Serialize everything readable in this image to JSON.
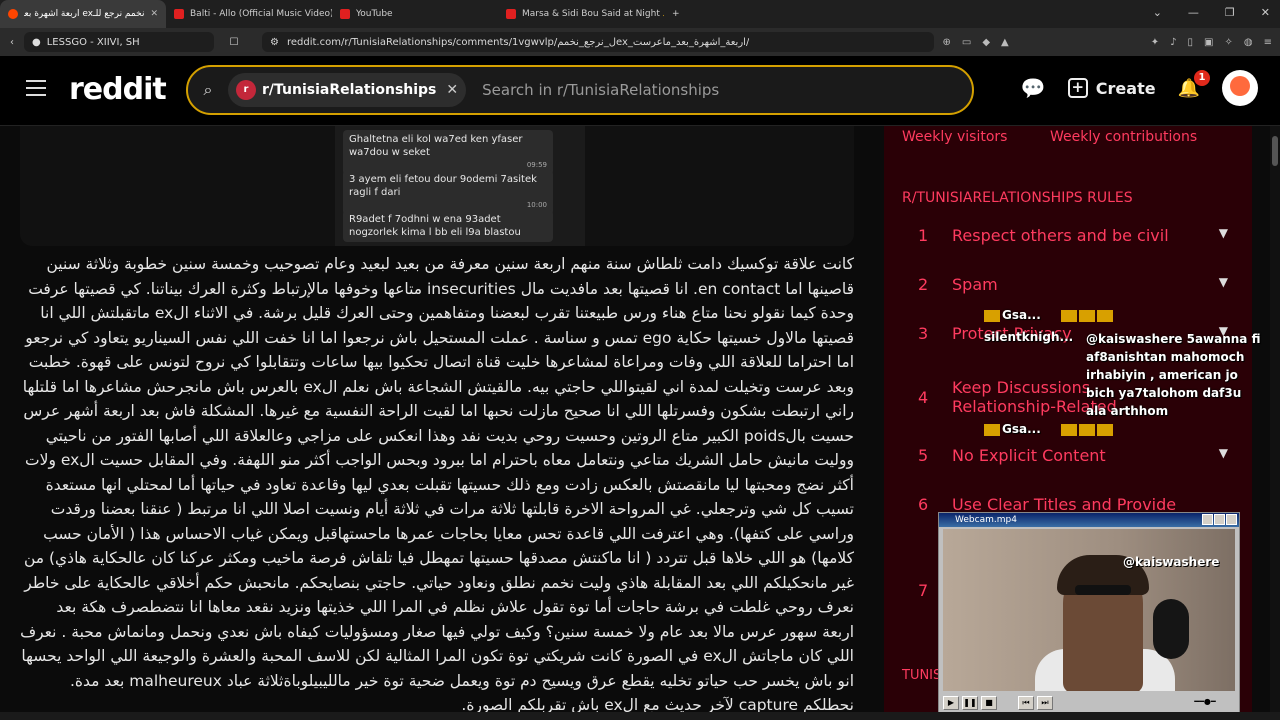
{
  "browser": {
    "tabs": [
      {
        "title": "نخمم نرجع للـex اربعة اشهرة بعد",
        "active": true
      },
      {
        "title": "Balti - Allo (Official Music Video) - Yo",
        "active": false
      },
      {
        "title": "YouTube",
        "active": false
      },
      {
        "title": "Marsa & Sidi Bou Said at Night 🌙 |",
        "active": false
      }
    ],
    "profile_label": "LESSGO - XIIVI, SH",
    "url": "reddit.com/r/TunisiaRelationships/comments/1vgwvlp/ل_نرجع_نخممex_اربعة_اشهرة_بعد_ماعرست/"
  },
  "header": {
    "logo": "reddit",
    "community_chip": "r/TunisiaRelationships",
    "search_placeholder": "Search in r/TunisiaRelationships",
    "create_label": "Create",
    "notification_count": "1"
  },
  "chat_image": {
    "messages": [
      {
        "text": "Ghaltetna eli kol wa7ed ken yfaser wa7dou w seket",
        "time": "09:59"
      },
      {
        "text": "3 ayem eli fetou dour 9odemi 7asitek ragli f dari",
        "time": "10:00"
      },
      {
        "text": "R9adet f 7odhni w ena 93adet nogzorlek kima l bb eli l9a blastou",
        "time": ""
      }
    ]
  },
  "post": {
    "paragraphs": [
      "كانت علاقة توكسيك دامت ثلطاش سنة منهم اربعة سنين معرفة من بعيد لبعيد وعام تصوحيب وخمسة سنين خطوبة وثلاثة سنين قاصينها اما en contact. انا قصيتها بعد مافديت مال insecurities متاعها وخوفها مالإرتباط وكثرة العرك بيناتنا. كي قصيتها عرفت وحدة كيما نقولو نحنا متاع هناء ورس طبيعتنا تقرب لبعضنا ومتفاهمين وحتى العرك قليل برشة. في الاثناء الex ماتقبلتش اللي انا قصيتها مالاول خسيتها حكاية ego تمس و سناسة . عملت المستحيل باش نرجعوا اما انا خفت اللي نفس السيناريو يتعاود كي نرجعو اما احتراما للعلاقة اللي وفات ومراعاة لمشاعرها خليت قناة اتصال تحكيوا بيها ساعات وتتقابلوا كي نروح لتونس على قهوة. خطبت وبعد عرست وتخيلت لمدة اني لقيتواللي حاجتي بيه. مالقيتش الشجاعة باش نعلم الex بالعرس باش مانجرحش مشاعرها اما قلتلها راني ارتبطت بشكون وفسرتلها اللي انا صحيح مازلت نحبها اما لقيت الراحة النفسية مع غيرها. المشكلة فاش بعد اربعة أشهر عرس حسيت بالpoids الكبير متاع الروتين وحسيت روحي بديت نفد وهذا انعكس على مزاجي وعالعلاقة اللي أصابها الفتور من ناحيتي ووليت مانيش حامل الشريك متاعي ونتعامل معاه باحترام اما ببرود وبحس الواجب أكثر منو اللهفة. وفي المقابل حسيت الex ولات أكثر نضج ومحبتها ليا مانقصتش بالعكس زادت ومع ذلك حسيتها تقبلت بعدي ليها وقاعدة تعاود في حياتها أما لمحتلي انها مستعدة تسيب كل شي وترجعلي. غي المرواحة الاخرة قابلتها ثلاثة مرات في ثلاثة أيام ونسيت اصلا اللي انا مرتبط ( عنقنا بعضنا ورقدت وراسي على كتفها). وهي اعترفت اللي قاعدة تحس معايا بحاجات عمرها ماحستهاقبل ويمكن غياب الاحساس هذا ( الأمان حسب كلامها) هو اللي خلاها قبل تتردد ( انا ماكنتش مصدقها حسيتها تمهطل فيا تلقاش فرصة ماخيب ومكثر عركنا كان عالحكاية هاذي) من غير مانحكيلكم اللي بعد المقابلة هاذي وليت نخمم نطلق ونعاود حياتي. حاجتي بنصايحكم. مانحبش حكم أخلاقي عالحكاية على خاطر نعرف روحي غلطت في برشة حاجات أما توة تقول علاش نظلم في المرا اللي خذيتها ونزيد نقعد معاها انا نتضطصرف هكة بعد اربعة سهور عرس مالا بعد عام ولا خمسة سنين؟ وكيف تولي فيها صغار ومسؤوليات كيفاه باش نعدي ونحمل ومانماش محبة . نعرف اللي كان ماجاتش الex في الصورة كانت شريكتي توة تكون المرا المثالية لكن للاسف المحبة والعشرة والوجيعة اللي الواحد يحسها انو باش يخسر حب حياتو تخليه يقطع عرق ويسيح دم توة ويعمل ضحية توة خير مالليبيلوباةثلاثة عباد malheureux بعد مدة. نحطلكم capture لآخر حديث مع الex باش تقربلكم الصورة."
    ]
  },
  "sidebar": {
    "weekly_visitors": "Weekly visitors",
    "weekly_contributions": "Weekly contributions",
    "rules_title": "R/TUNISIARELATIONSHIPS RULES",
    "rules": [
      {
        "n": "1",
        "label": "Respect others and be civil"
      },
      {
        "n": "2",
        "label": "Spam"
      },
      {
        "n": "3",
        "label": "Protect Privacy"
      },
      {
        "n": "4",
        "label": "Keep Discussions Relationship-Related"
      },
      {
        "n": "5",
        "label": "No Explicit Content"
      },
      {
        "n": "6",
        "label": "Use Clear Titles and Provide"
      },
      {
        "n": "7",
        "label": ""
      }
    ],
    "footer_fragment": "TUNISI"
  },
  "stream_overlay": {
    "chat_user_1": "Gsa...",
    "chat_user_2": "silentknigh...",
    "chat_handle": "@kaiswashere",
    "chat_message": "5awanna fi af8anishtan mahomoch irhabiyin , american jo bich ya7talohom daf3u ala arthhom",
    "chat_user_3": "Gsa...",
    "webcam_title": "Webcam.mp4",
    "webcam_handle": "@kaiswashere"
  }
}
